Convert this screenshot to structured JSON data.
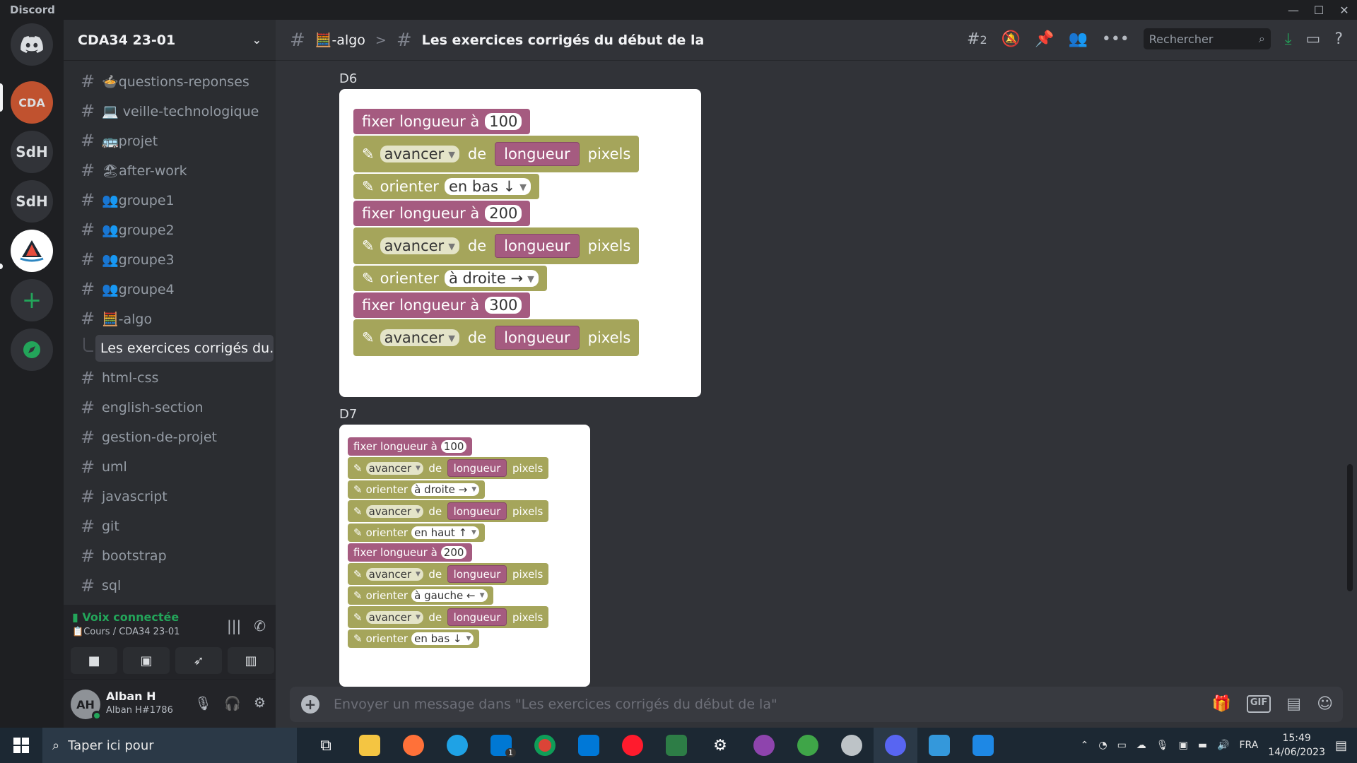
{
  "window": {
    "app_name": "Discord",
    "controls": [
      "—",
      "☐",
      "✕"
    ]
  },
  "guilds": {
    "items": [
      {
        "name": "discord-home",
        "label": ""
      },
      {
        "name": "cda34",
        "label": "CDA"
      },
      {
        "name": "sdh-1",
        "label": "SdH"
      },
      {
        "name": "sdh-2",
        "label": "SdH"
      },
      {
        "name": "sailboat-server",
        "label": ""
      }
    ],
    "add_label": "+",
    "explore_label": "◉"
  },
  "sidebar": {
    "server_name": "CDA34 23-01",
    "channels": [
      {
        "label": "🍲questions-reponses"
      },
      {
        "label": "💻 veille-technologique"
      },
      {
        "label": "🚌projet"
      },
      {
        "label": "🏖after-work"
      },
      {
        "label": "👥groupe1"
      },
      {
        "label": "👥groupe2"
      },
      {
        "label": "👥groupe3"
      },
      {
        "label": "👥groupe4"
      },
      {
        "label": "🧮-algo"
      },
      {
        "label": "Les exercices corrigés du..."
      },
      {
        "label": "html-css"
      },
      {
        "label": "english-section"
      },
      {
        "label": "gestion-de-projet"
      },
      {
        "label": "uml"
      },
      {
        "label": "javascript"
      },
      {
        "label": "git"
      },
      {
        "label": "bootstrap"
      },
      {
        "label": "sql"
      }
    ]
  },
  "voice": {
    "status": "Voix connectée",
    "channel": "📋Cours / CDA34 23-01"
  },
  "user": {
    "name": "Alban H",
    "tag": "Alban H#1786",
    "avatar_initials": "AH"
  },
  "topbar": {
    "channel": "🧮-algo",
    "separator": ">",
    "thread_title": "Les exercices corrigés du début de la",
    "threads_count": "2",
    "search_placeholder": "Rechercher"
  },
  "messages": {
    "d6": {
      "label": "D6",
      "blocks": [
        {
          "kind": "set",
          "text": "fixer longueur à",
          "value": "100"
        },
        {
          "kind": "move",
          "verb": "avancer",
          "de": "de",
          "var": "longueur",
          "unit": "pixels"
        },
        {
          "kind": "orient",
          "verb": "orienter",
          "dir": "en bas ↓"
        },
        {
          "kind": "set",
          "text": "fixer longueur à",
          "value": "200"
        },
        {
          "kind": "move",
          "verb": "avancer",
          "de": "de",
          "var": "longueur",
          "unit": "pixels"
        },
        {
          "kind": "orient",
          "verb": "orienter",
          "dir": "à droite →"
        },
        {
          "kind": "set",
          "text": "fixer longueur à",
          "value": "300"
        },
        {
          "kind": "move",
          "verb": "avancer",
          "de": "de",
          "var": "longueur",
          "unit": "pixels"
        }
      ]
    },
    "d7": {
      "label": "D7",
      "blocks": [
        {
          "kind": "set",
          "text": "fixer longueur à",
          "value": "100"
        },
        {
          "kind": "move",
          "verb": "avancer",
          "de": "de",
          "var": "longueur",
          "unit": "pixels"
        },
        {
          "kind": "orient",
          "verb": "orienter",
          "dir": "à droite →"
        },
        {
          "kind": "move",
          "verb": "avancer",
          "de": "de",
          "var": "longueur",
          "unit": "pixels"
        },
        {
          "kind": "orient",
          "verb": "orienter",
          "dir": "en haut ↑"
        },
        {
          "kind": "set",
          "text": "fixer longueur à",
          "value": "200"
        },
        {
          "kind": "move",
          "verb": "avancer",
          "de": "de",
          "var": "longueur",
          "unit": "pixels"
        },
        {
          "kind": "orient",
          "verb": "orienter",
          "dir": "à gauche ←"
        },
        {
          "kind": "move",
          "verb": "avancer",
          "de": "de",
          "var": "longueur",
          "unit": "pixels"
        },
        {
          "kind": "orient",
          "verb": "orienter",
          "dir": "en bas ↓"
        }
      ]
    }
  },
  "composer": {
    "placeholder": "Envoyer un message dans \"Les exercices corrigés du début de la\"",
    "gif_label": "GIF"
  },
  "taskbar": {
    "search_placeholder": "Taper ici pour",
    "mail_badge": "1",
    "language": "FRA",
    "time": "15:49",
    "date": "14/06/2023"
  },
  "colors": {
    "accent_green": "#23a55a",
    "block_pink": "#a55b80",
    "block_olive": "#a5a55b"
  }
}
